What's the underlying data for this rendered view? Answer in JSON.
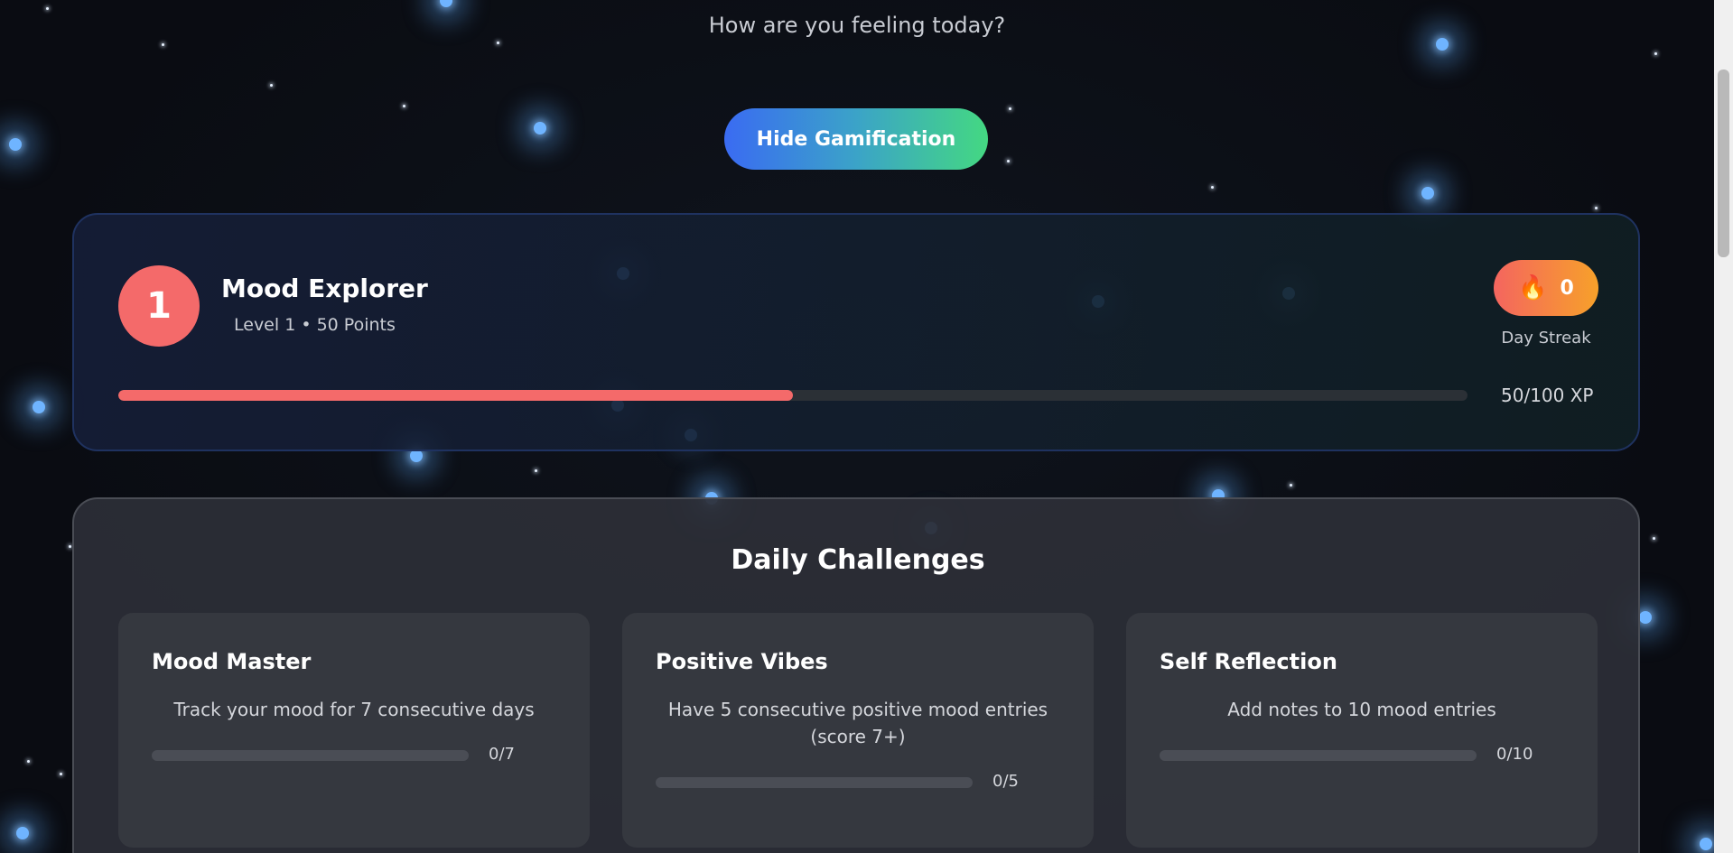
{
  "header": {
    "question": "How are you feeling today?"
  },
  "toggle": {
    "label": "Hide Gamification"
  },
  "level": {
    "number": "1",
    "title": "Mood Explorer",
    "subtitle": "Level 1 • 50 Points",
    "streak_value": "0",
    "streak_label": "Day Streak",
    "xp_text": "50/100 XP",
    "xp_progress": 0.5
  },
  "challenges": {
    "title": "Daily Challenges",
    "items": [
      {
        "name": "Mood Master",
        "description": "Track your mood for 7 consecutive days",
        "count": "0/7",
        "progress": 0
      },
      {
        "name": "Positive Vibes",
        "description": "Have 5 consecutive positive mood entries (score 7+)",
        "count": "0/5",
        "progress": 0
      },
      {
        "name": "Self Reflection",
        "description": "Add notes to 10 mood entries",
        "count": "0/10",
        "progress": 0
      }
    ]
  },
  "colors": {
    "accent": "#f46a6a",
    "streak_from": "#f4655f",
    "streak_to": "#f7a12a",
    "button_from": "#3a6bf2",
    "button_to": "#44d882"
  },
  "icons": {
    "streak": "flame-icon"
  }
}
